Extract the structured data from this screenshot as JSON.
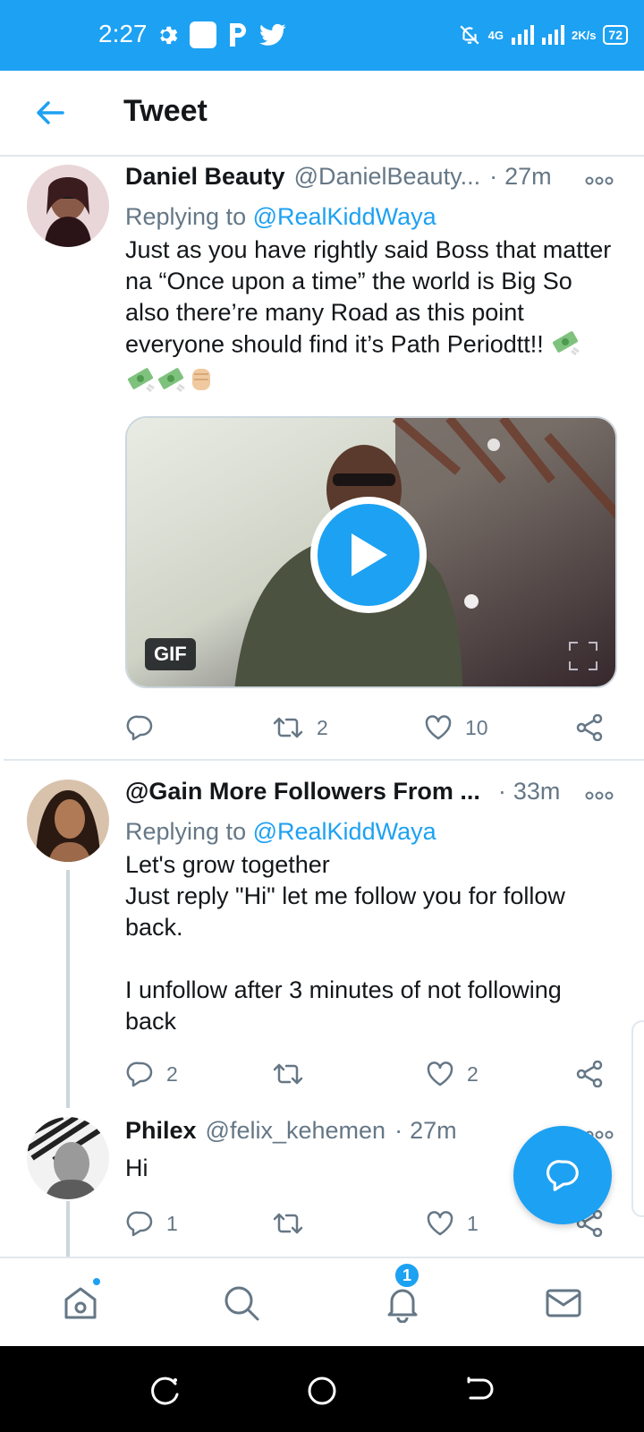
{
  "status_bar": {
    "time": "2:27",
    "network_label": "4G",
    "speed_value": "2",
    "speed_unit": "K/s",
    "battery": "72"
  },
  "header": {
    "title": "Tweet"
  },
  "tweets": [
    {
      "name": "Daniel Beauty",
      "handle": "@DanielBeauty...",
      "time": "27m",
      "replying_prefix": "Replying to",
      "replying_to": "@RealKiddWaya",
      "text": "Just as you have rightly said Boss that matter na “Once upon a time” the world is Big So also there’re many Road as this point everyone should find it’s Path Periodtt!! ",
      "media_badge": "GIF",
      "retweets": "2",
      "likes": "10",
      "replies": ""
    },
    {
      "name": "@Gain More Followers From ...",
      "handle": "",
      "time": "33m",
      "replying_prefix": "Replying to",
      "replying_to": "@RealKiddWaya",
      "text": "Let's grow together\nJust reply \"Hi\" let me follow you for follow back.\n\nI unfollow after 3 minutes of not following back",
      "replies": "2",
      "retweets": "",
      "likes": "2"
    },
    {
      "name": "Philex",
      "handle": "@felix_kehemen",
      "time": "27m",
      "text": "Hi",
      "replies": "1",
      "retweets": "",
      "likes": "1"
    }
  ],
  "bottom_nav": {
    "notifications_badge": "1"
  },
  "colors": {
    "brand": "#1da1f2",
    "secondary_text": "#657786",
    "primary_text": "#14171a",
    "divider": "#e1e8ed"
  },
  "icons": {
    "back": "arrow-left-icon",
    "more": "more-dots-icon",
    "reply": "reply-bubble-icon",
    "retweet": "retweet-icon",
    "like": "heart-icon",
    "share": "share-icon",
    "home": "home-icon",
    "search": "search-icon",
    "notifications": "bell-icon",
    "messages": "envelope-icon",
    "compose": "compose-reply-icon"
  }
}
